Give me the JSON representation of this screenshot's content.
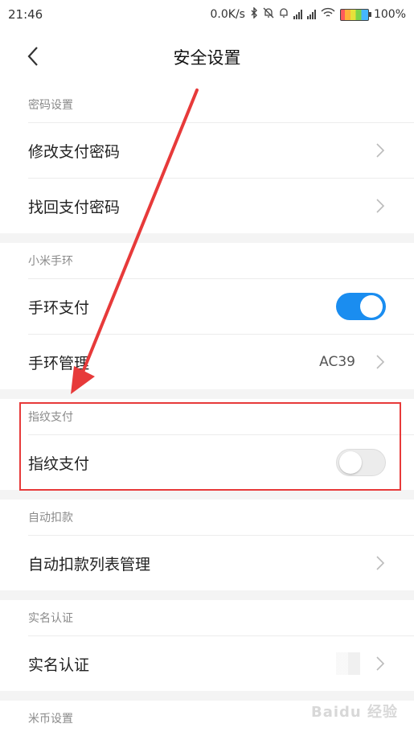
{
  "status_bar": {
    "time": "21:46",
    "network_speed": "0.0K/s",
    "battery": "100%"
  },
  "header": {
    "title": "安全设置"
  },
  "sections": {
    "password": {
      "title": "密码设置",
      "items": [
        {
          "label": "修改支付密码"
        },
        {
          "label": "找回支付密码"
        }
      ]
    },
    "band": {
      "title": "小米手环",
      "items": [
        {
          "label": "手环支付",
          "toggle": true
        },
        {
          "label": "手环管理",
          "value": "AC39"
        }
      ]
    },
    "fingerprint": {
      "title": "指纹支付",
      "items": [
        {
          "label": "指纹支付",
          "toggle": false
        }
      ]
    },
    "autopay": {
      "title": "自动扣款",
      "items": [
        {
          "label": "自动扣款列表管理"
        }
      ]
    },
    "realname": {
      "title": "实名认证",
      "items": [
        {
          "label": "实名认证"
        }
      ]
    },
    "micoin": {
      "title": "米币设置"
    }
  },
  "watermark": "Baidu 经验",
  "colors": {
    "accent": "#1a8df0",
    "highlight": "#e73a3a"
  }
}
